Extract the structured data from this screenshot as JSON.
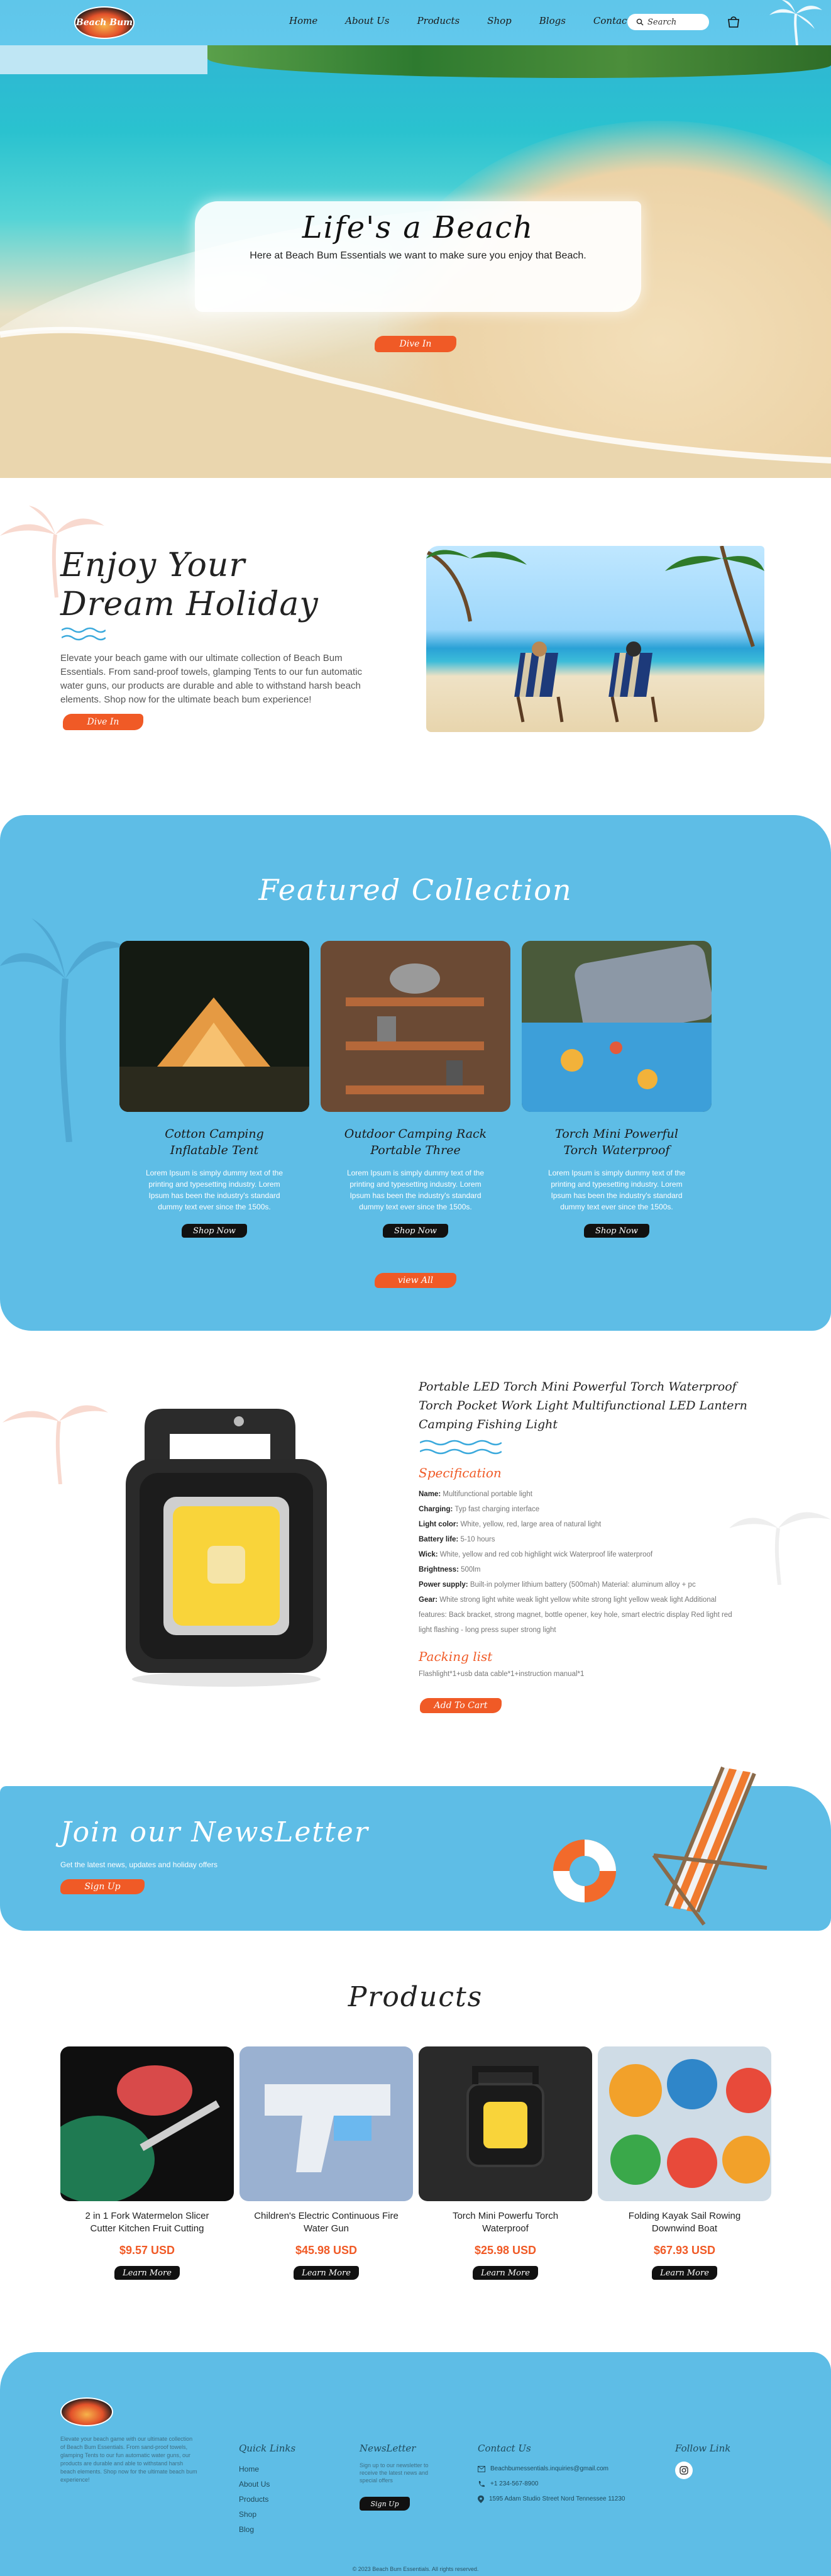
{
  "header": {
    "logo_text": "Beach Bum",
    "nav": [
      "Home",
      "About Us",
      "Products",
      "Shop",
      "Blogs",
      "Contact Us"
    ],
    "search_placeholder": "Search"
  },
  "hero": {
    "title": "Life's a Beach",
    "subtitle": "Here at Beach Bum Essentials we want to make sure you enjoy that Beach.",
    "button": "Dive In"
  },
  "holiday": {
    "title_line1": "Enjoy Your",
    "title_line2": "Dream Holiday",
    "text": "Elevate your beach game with our ultimate collection of Beach Bum Essentials. From sand-proof towels, glamping Tents to our fun automatic water guns, our products are durable and able to withstand harsh beach elements. Shop now for the ultimate beach bum experience!",
    "button": "Dive In"
  },
  "featured": {
    "title": "Featured Collection",
    "items": [
      {
        "name_line1": "Cotton Camping",
        "name_line2": "Inflatable Tent",
        "text": "Lorem Ipsum is simply dummy text of the printing and typesetting industry. Lorem Ipsum has been the industry's standard dummy text ever since the 1500s.",
        "button": "Shop Now"
      },
      {
        "name_line1": "Outdoor Camping Rack",
        "name_line2": "Portable Three",
        "text": "Lorem Ipsum is simply dummy text of the printing and typesetting industry. Lorem Ipsum has been the industry's standard dummy text ever since the 1500s.",
        "button": "Shop Now"
      },
      {
        "name_line1": "Torch Mini Powerful",
        "name_line2": "Torch Waterproof",
        "text": "Lorem Ipsum is simply dummy text of the printing and typesetting industry. Lorem Ipsum has been the industry's standard dummy text ever since the 1500s.",
        "button": "Shop Now"
      }
    ],
    "view_all": "view All"
  },
  "product_detail": {
    "title": "Portable LED Torch Mini Powerful Torch Waterproof Torch Pocket Work Light Multifunctional LED Lantern Camping Fishing Light",
    "spec_heading": "Specification",
    "specs": [
      {
        "label": "Name:",
        "value": "Multifunctional portable light"
      },
      {
        "label": "Charging:",
        "value": "Typ fast charging interface"
      },
      {
        "label": "Light color:",
        "value": "White, yellow, red, large area of natural light"
      },
      {
        "label": "Battery life:",
        "value": "5-10 hours"
      },
      {
        "label": "Wick:",
        "value": "White, yellow and red cob highlight wick Waterproof life waterproof"
      },
      {
        "label": "Brightness:",
        "value": "500lm"
      },
      {
        "label": "Power supply:",
        "value": "Built-in polymer lithium battery (500mah) Material: aluminum alloy + pc"
      },
      {
        "label": "Gear:",
        "value": "White strong light white weak light yellow white strong light yellow weak light Additional features: Back bracket, strong magnet, bottle opener, key hole, smart electric display Red light red light flashing - long press super strong light"
      }
    ],
    "packing_heading": "Packing list",
    "packing_text": "Flashlight*1+usb data cable*1+instruction manual*1",
    "button": "Add To Cart"
  },
  "newsletter": {
    "title": "Join our NewsLetter",
    "subtitle": "Get the latest news, updates and holiday offers",
    "button": "Sign Up"
  },
  "products": {
    "title": "Products",
    "items": [
      {
        "name": "2 in 1 Fork Watermelon Slicer Cutter Kitchen Fruit Cutting",
        "price": "$9.57 USD",
        "button": "Learn More"
      },
      {
        "name": "Children's Electric Continuous Fire Water Gun",
        "price": "$45.98 USD",
        "button": "Learn More"
      },
      {
        "name": "Torch Mini Powerfu Torch Waterproof",
        "price": "$25.98 USD",
        "button": "Learn More"
      },
      {
        "name": "Folding Kayak Sail Rowing Downwind Boat",
        "price": "$67.93 USD",
        "button": "Learn More"
      }
    ]
  },
  "footer": {
    "description": "Elevate your beach game with our ultimate collection of Beach Bum Essentials. From sand-proof towels, glamping Tents to our fun automatic water guns, our products are durable and able to withstand harsh beach elements. Shop now for the ultimate beach bum experience!",
    "quick_links_heading": "Quick Links",
    "quick_links": [
      "Home",
      "About Us",
      "Products",
      "Shop",
      "Blog"
    ],
    "newsletter_heading": "NewsLetter",
    "newsletter_text": "Sign up to our newsletter to receive the latest news and special offers",
    "newsletter_button": "Sign Up",
    "contact_heading": "Contact Us",
    "email": "Beachbumessentials.inquiries@gmail.com",
    "phone": "+1 234-567-8900",
    "address": "1595 Adam Studio Street Nord Tennessee 11230",
    "follow_heading": "Follow Link",
    "copyright": "© 2023 Beach Bum Essentials. All rights reserved."
  },
  "colors": {
    "accent": "#f05a26",
    "sky_blue": "#5ebde6",
    "dark": "#111111"
  }
}
